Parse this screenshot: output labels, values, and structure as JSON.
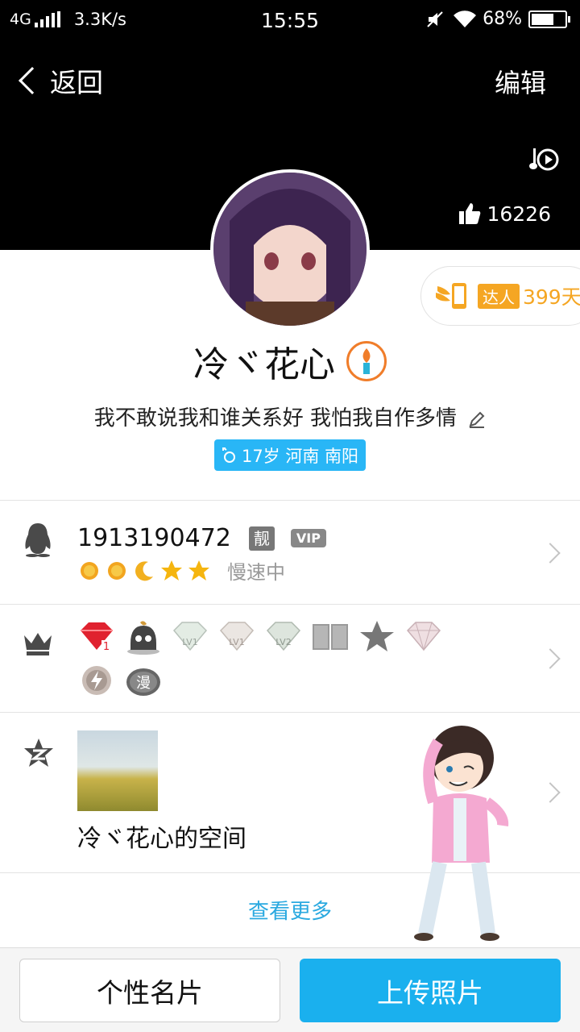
{
  "status_bar": {
    "network": "4G",
    "speed": "3.3K/s",
    "time": "15:55",
    "battery": "68%",
    "battery_level": 0.68
  },
  "header": {
    "back_label": "返回",
    "edit_label": "编辑",
    "likes": "16226"
  },
  "profile": {
    "daren_tag": "达人",
    "daren_days": "399天",
    "nickname": "冷ヾ花心",
    "signature": "我不敢说我和谁关系好 我怕我自作多情",
    "info_badge": "17岁 河南 南阳"
  },
  "qq_row": {
    "number": "1913190472",
    "liang_badge": "靓",
    "vip_badge": "VIP",
    "level_status": "慢速中"
  },
  "medals": {
    "labels": [
      "LV1",
      "LV1",
      "LV2"
    ],
    "manga_label": "漫",
    "rank_number": "1"
  },
  "space_row": {
    "name": "冷ヾ花心的空间"
  },
  "more_label": "查看更多",
  "bottom": {
    "card_label": "个性名片",
    "upload_label": "上传照片"
  },
  "colors": {
    "accent": "#1ab0ee",
    "link": "#2aa9e0",
    "badge_blue": "#29b6f6",
    "daren_orange": "#f5a623"
  }
}
